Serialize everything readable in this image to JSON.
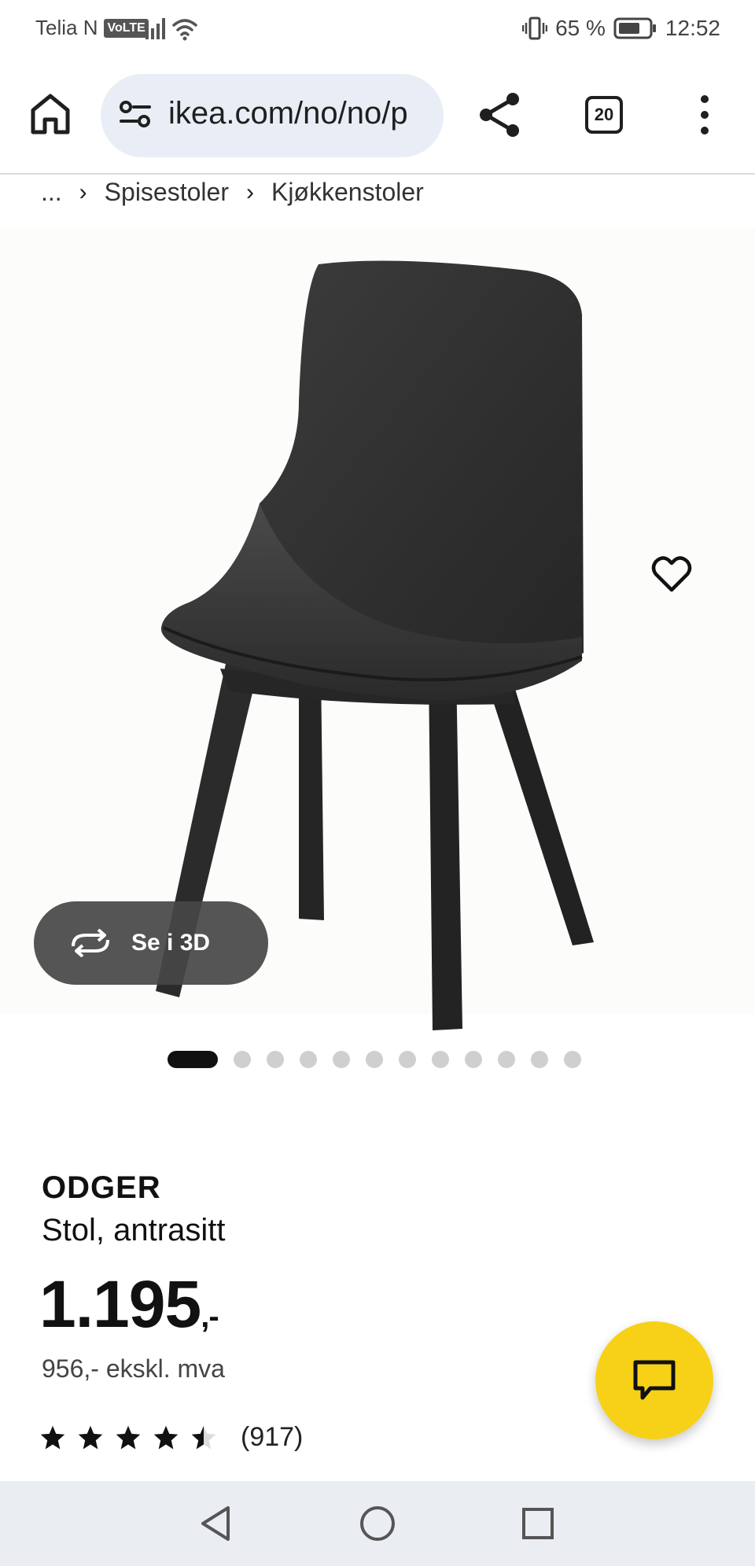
{
  "status_bar": {
    "carrier": "Telia N",
    "volte": "VoLTE",
    "battery": "65 %",
    "time": "12:52",
    "icons": [
      "signal-icon",
      "wifi-icon",
      "vibrate-icon",
      "battery-icon"
    ]
  },
  "browser": {
    "url": "ikea.com/no/no/p",
    "tab_count": "20",
    "icons": [
      "home-icon",
      "site-settings-icon",
      "share-icon",
      "more-vert-icon"
    ]
  },
  "breadcrumb": {
    "ellipsis": "...",
    "items": [
      "Spisestoler",
      "Kjøkkenstoler"
    ]
  },
  "gallery": {
    "view_3d_label": "Se i 3D",
    "image_count": 12,
    "active_index": 0
  },
  "product": {
    "name": "ODGER",
    "description": "Stol, antrasitt",
    "price": "1.195",
    "price_suffix": ",-",
    "price_ex_vat": "956,- ekskl. mva",
    "rating": 4.5,
    "rating_max": 5,
    "rating_count": "(917)"
  },
  "colors": {
    "accent_yellow": "#f7d117",
    "url_bar_bg": "#e9eef6",
    "nav_bar_bg": "#eaedf1"
  }
}
